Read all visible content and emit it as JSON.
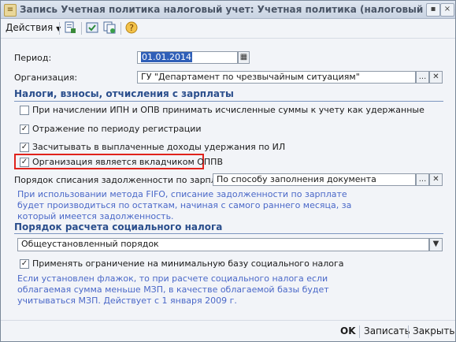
{
  "window": {
    "title": "Запись Учетная политика налоговый учет: Учетная политика (налоговый учет):",
    "close_glyph": "×"
  },
  "toolbar": {
    "actions_label": "Действия",
    "icons": [
      "document-icon",
      "save-icon",
      "copy-icon",
      "help-icon"
    ]
  },
  "form": {
    "period_label": "Период:",
    "period_value": "01.01.2014",
    "org_label": "Организация:",
    "org_value": "ГУ \"Департамент по чрезвычайным ситуациям\"",
    "section1_title": "Налоги, взносы, отчисления с зарплаты",
    "checkboxes": [
      {
        "label": "При начислении ИПН и ОПВ принимать исчисленные суммы к учету как удержанные",
        "checked": false
      },
      {
        "label": "Отражение по периоду регистрации",
        "checked": true
      },
      {
        "label": "Засчитывать в выплаченные доходы удержания по ИЛ",
        "checked": true
      },
      {
        "label": "Организация является вкладчиком ОППВ",
        "checked": true
      }
    ],
    "debt_order_label": "Порядок списания задолженности по зарплате:",
    "debt_order_value": "По способу заполнения документа",
    "debt_hint": "При использовании метода FIFO, списание задолженности по зарплате будет производиться по остаткам, начиная с самого раннего месяца, за который имеется задолженность.",
    "section2_title": "Порядок расчета социального налога",
    "social_select_value": "Общеустановленный порядок",
    "min_base_label": "Применять ограничение на минимальную базу социального налога",
    "min_base_checked": true,
    "min_base_hint": "Если установлен флажок, то при расчете социального налога если облагаемая сумма меньше МЗП, в качестве облагаемой базы будет учитываться МЗП. Действует с 1 января 2009 г."
  },
  "buttons": {
    "ok": "OK",
    "save": "Записать",
    "close": "Закрыть"
  },
  "colors": {
    "section_title": "#2a4e8c",
    "hint_text": "#4a68c8",
    "highlight_border": "#e0231c",
    "selected_period_bg": "#2f5fb8"
  }
}
